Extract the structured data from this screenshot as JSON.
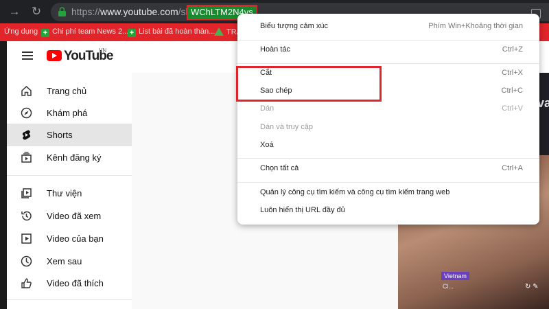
{
  "browser": {
    "back_icon": "back-arrow-icon",
    "reload_icon": "reload-icon",
    "url_prefix": "https://www.youtube.com/shorts/",
    "url_host": "www.youtube.com",
    "url_scheme": "https://",
    "url_path": "/shorts/",
    "url_selected": "WChLTM2N4vs"
  },
  "bookmarks": [
    {
      "label": "Ứng dụng"
    },
    {
      "label": "Chi phí team News 2..."
    },
    {
      "label": "List bài đã hoàn thàn..."
    },
    {
      "label": "TRA"
    }
  ],
  "youtube": {
    "logo_text": "YouTube",
    "region": "VN"
  },
  "sidebar": {
    "items": [
      {
        "label": "Trang chủ",
        "icon": "home-icon"
      },
      {
        "label": "Khám phá",
        "icon": "compass-icon"
      },
      {
        "label": "Shorts",
        "icon": "shorts-icon",
        "active": true
      },
      {
        "label": "Kênh đăng ký",
        "icon": "subscriptions-icon"
      },
      {
        "label": "Thư viện",
        "icon": "library-icon"
      },
      {
        "label": "Video đã xem",
        "icon": "history-icon"
      },
      {
        "label": "Video của bạn",
        "icon": "your-videos-icon"
      },
      {
        "label": "Xem sau",
        "icon": "watch-later-icon"
      },
      {
        "label": "Video đã thích",
        "icon": "like-icon"
      }
    ]
  },
  "video": {
    "overlay_text": "va",
    "tag": "Vietnam",
    "sub_tag": "Cl..."
  },
  "context_menu": {
    "items": [
      {
        "label": "Biểu tượng cảm xúc",
        "shortcut": "Phím Win+Khoảng thời gian",
        "disabled": false
      },
      {
        "label": "Hoàn tác",
        "shortcut": "Ctrl+Z",
        "disabled": false
      },
      {
        "label": "Cắt",
        "shortcut": "Ctrl+X",
        "disabled": false
      },
      {
        "label": "Sao chép",
        "shortcut": "Ctrl+C",
        "disabled": false
      },
      {
        "label": "Dán",
        "shortcut": "Ctrl+V",
        "disabled": true
      },
      {
        "label": "Dán và truy cập",
        "shortcut": "",
        "disabled": true
      },
      {
        "label": "Xoá",
        "shortcut": "",
        "disabled": false
      },
      {
        "label": "Chọn tất cả",
        "shortcut": "Ctrl+A",
        "disabled": false
      },
      {
        "label": "Quản lý công cụ tìm kiếm và công cụ tìm kiếm trang web",
        "shortcut": "",
        "disabled": false
      },
      {
        "label": "Luôn hiển thị URL đầy đủ",
        "shortcut": "",
        "disabled": false
      }
    ]
  },
  "colors": {
    "bookmark_bar": "#e1252b",
    "highlight": "#e0242b",
    "selection": "#1a8a2f",
    "youtube_red": "#ff0000"
  }
}
